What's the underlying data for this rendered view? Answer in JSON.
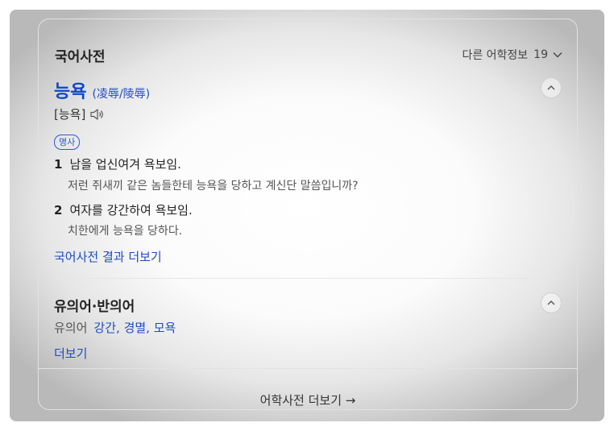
{
  "header": {
    "title": "국어사전",
    "more_label": "다른 어학정보",
    "more_count": "19",
    "icon": "chevron-down-icon"
  },
  "entry": {
    "headword": "능욕",
    "hanja": "(凌辱/陵辱)",
    "pronunciation": "[능욕]",
    "pos": "명사",
    "senses": [
      {
        "num": "1",
        "definition": "남을 업신여겨 욕보임.",
        "example": "저런 쥐새끼 같은 놈들한테 능욕을 당하고 계신단 말씀입니까?"
      },
      {
        "num": "2",
        "definition": "여자를 강간하여 욕보임.",
        "example": "치한에게 능욕을 당하다."
      }
    ],
    "more_link": "국어사전 결과 더보기"
  },
  "synonyms": {
    "title": "유의어·반의어",
    "label": "유의어",
    "words": [
      "강간",
      "경멸",
      "모욕"
    ],
    "more_link": "더보기"
  },
  "footer": {
    "link": "어학사전 더보기 →"
  },
  "colors": {
    "headword": "#0d47c8",
    "link": "#1d4cc4",
    "badge": "#2a5bd4"
  }
}
